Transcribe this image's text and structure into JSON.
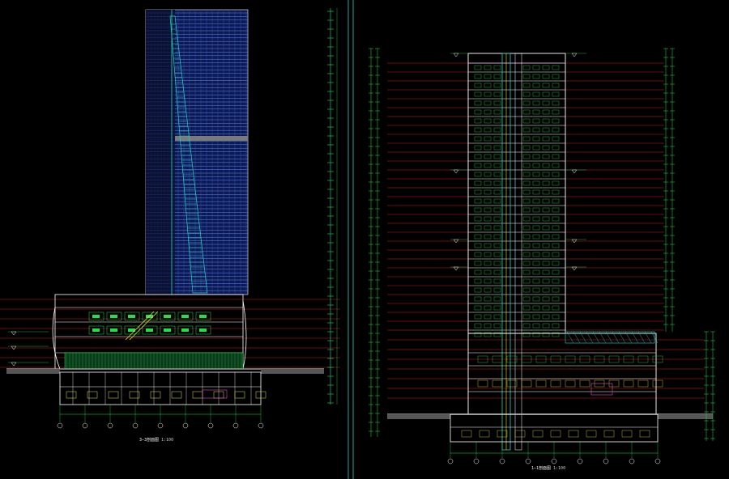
{
  "drawing": {
    "left_section": {
      "title": "3—3剖面图",
      "scale": "1:100"
    },
    "right_section": {
      "title": "1—1剖面图",
      "scale": "1:100"
    }
  },
  "colors": {
    "background": "#000000",
    "floor_line": "#d11a1a",
    "structure": "#ffffff",
    "curtain_wall": "#1a3fa8",
    "curtain_grid": "#6a86e8",
    "mullion_cyan": "#1fd3c6",
    "green_annotation": "#22e04a",
    "yellow_annotation": "#e8e035",
    "magenta": "#e04adc",
    "grey_ground": "#9a9a9a"
  },
  "icons": {
    "level_marker": "level-triangle-icon",
    "axis_bubble": "axis-bubble-icon"
  }
}
